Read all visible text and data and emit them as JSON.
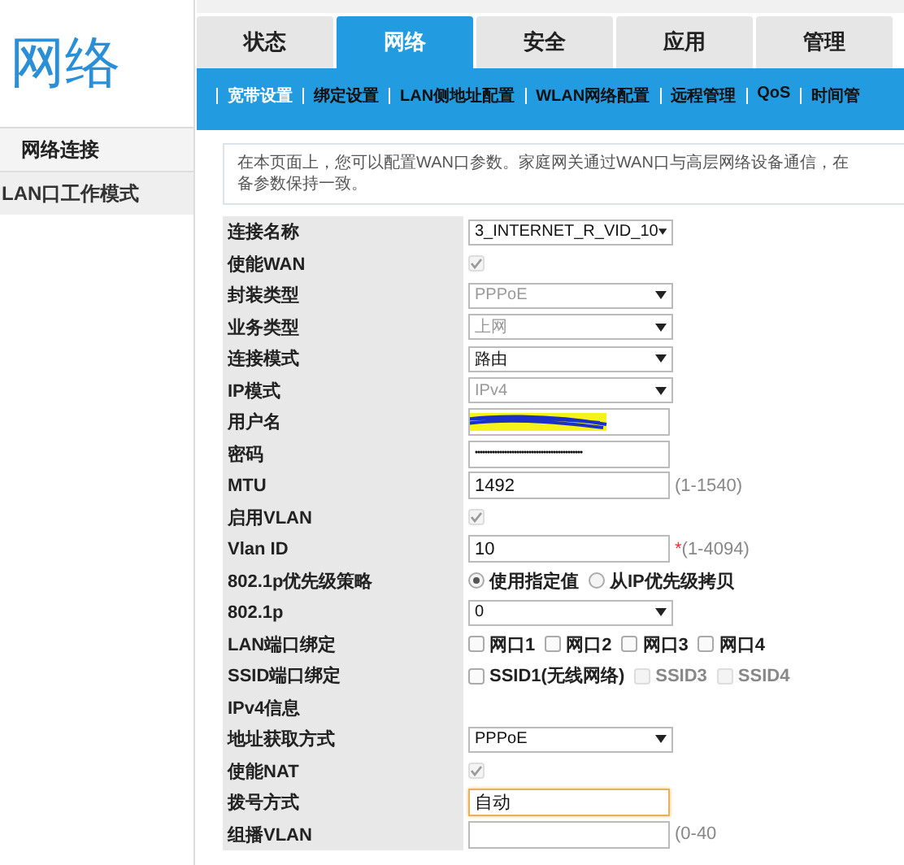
{
  "sidebar": {
    "title": "网络",
    "items": [
      {
        "label": "网络连接",
        "selected": true
      },
      {
        "label": "LAN口工作模式",
        "selected": false
      }
    ]
  },
  "tabs": [
    {
      "label": "状态",
      "selected": false
    },
    {
      "label": "网络",
      "selected": true
    },
    {
      "label": "安全",
      "selected": false
    },
    {
      "label": "应用",
      "selected": false
    },
    {
      "label": "管理",
      "selected": false
    }
  ],
  "subnav": [
    {
      "label": "宽带设置",
      "selected": true
    },
    {
      "label": "绑定设置",
      "selected": false
    },
    {
      "label": "LAN侧地址配置",
      "selected": false
    },
    {
      "label": "WLAN网络配置",
      "selected": false
    },
    {
      "label": "远程管理",
      "selected": false
    },
    {
      "label": "QoS",
      "selected": false
    },
    {
      "label": "时间管",
      "selected": false
    }
  ],
  "description": [
    "在本页面上，您可以配置WAN口参数。家庭网关通过WAN口与高层网络设备通信，在",
    "备参数保持一致。"
  ],
  "form": [
    {
      "label": "连接名称",
      "kind": "select",
      "value": "3_INTERNET_R_VID_10",
      "disabled": false
    },
    {
      "label": "使能WAN",
      "kind": "checkbox",
      "checked": true,
      "disabled": true
    },
    {
      "label": "封装类型",
      "kind": "select",
      "value": "PPPoE",
      "disabled": true
    },
    {
      "label": "业务类型",
      "kind": "select",
      "value": "上网",
      "disabled": true
    },
    {
      "label": "连接模式",
      "kind": "select",
      "value": "路由",
      "disabled": false
    },
    {
      "label": "IP模式",
      "kind": "select",
      "value": "IPv4",
      "disabled": true
    },
    {
      "label": "用户名",
      "kind": "text",
      "redacted": true
    },
    {
      "label": "密码",
      "kind": "text",
      "value": "••••••••••••••••••••••••••••••••••••••••••••"
    },
    {
      "label": "MTU",
      "kind": "text",
      "value": "1492",
      "hint": "(1-1540)"
    },
    {
      "label": "启用VLAN",
      "kind": "checkbox",
      "checked": true,
      "disabled": true
    },
    {
      "label": "Vlan ID",
      "kind": "text",
      "value": "10",
      "required": "*",
      "hint": "(1-4094)"
    },
    {
      "label": "802.1p优先级策略",
      "kind": "radio",
      "options": [
        {
          "label": "使用指定值",
          "selected": true
        },
        {
          "label": "从IP优先级拷贝",
          "selected": false
        }
      ]
    },
    {
      "label": "802.1p",
      "kind": "select",
      "value": "0",
      "disabled": false
    },
    {
      "label": "LAN端口绑定",
      "kind": "checks",
      "options": [
        {
          "label": "网口1",
          "checked": false,
          "disabled": false
        },
        {
          "label": "网口2",
          "checked": false,
          "disabled": false
        },
        {
          "label": "网口3",
          "checked": false,
          "disabled": false
        },
        {
          "label": "网口4",
          "checked": false,
          "disabled": false
        }
      ]
    },
    {
      "label": "SSID端口绑定",
      "kind": "checks",
      "options": [
        {
          "label": "SSID1(无线网络)",
          "checked": false,
          "disabled": false
        },
        {
          "label": "SSID3",
          "checked": false,
          "disabled": true
        },
        {
          "label": "SSID4",
          "checked": false,
          "disabled": true
        }
      ]
    },
    {
      "label": "IPv4信息",
      "kind": "heading"
    },
    {
      "label": "地址获取方式",
      "kind": "select",
      "value": "PPPoE",
      "disabled": false
    },
    {
      "label": "使能NAT",
      "kind": "checkbox",
      "checked": true,
      "disabled": true
    },
    {
      "label": "拨号方式",
      "kind": "text",
      "value": "自动",
      "focused": true
    },
    {
      "label": "组播VLAN",
      "kind": "text",
      "hint": "(0-40"
    }
  ]
}
